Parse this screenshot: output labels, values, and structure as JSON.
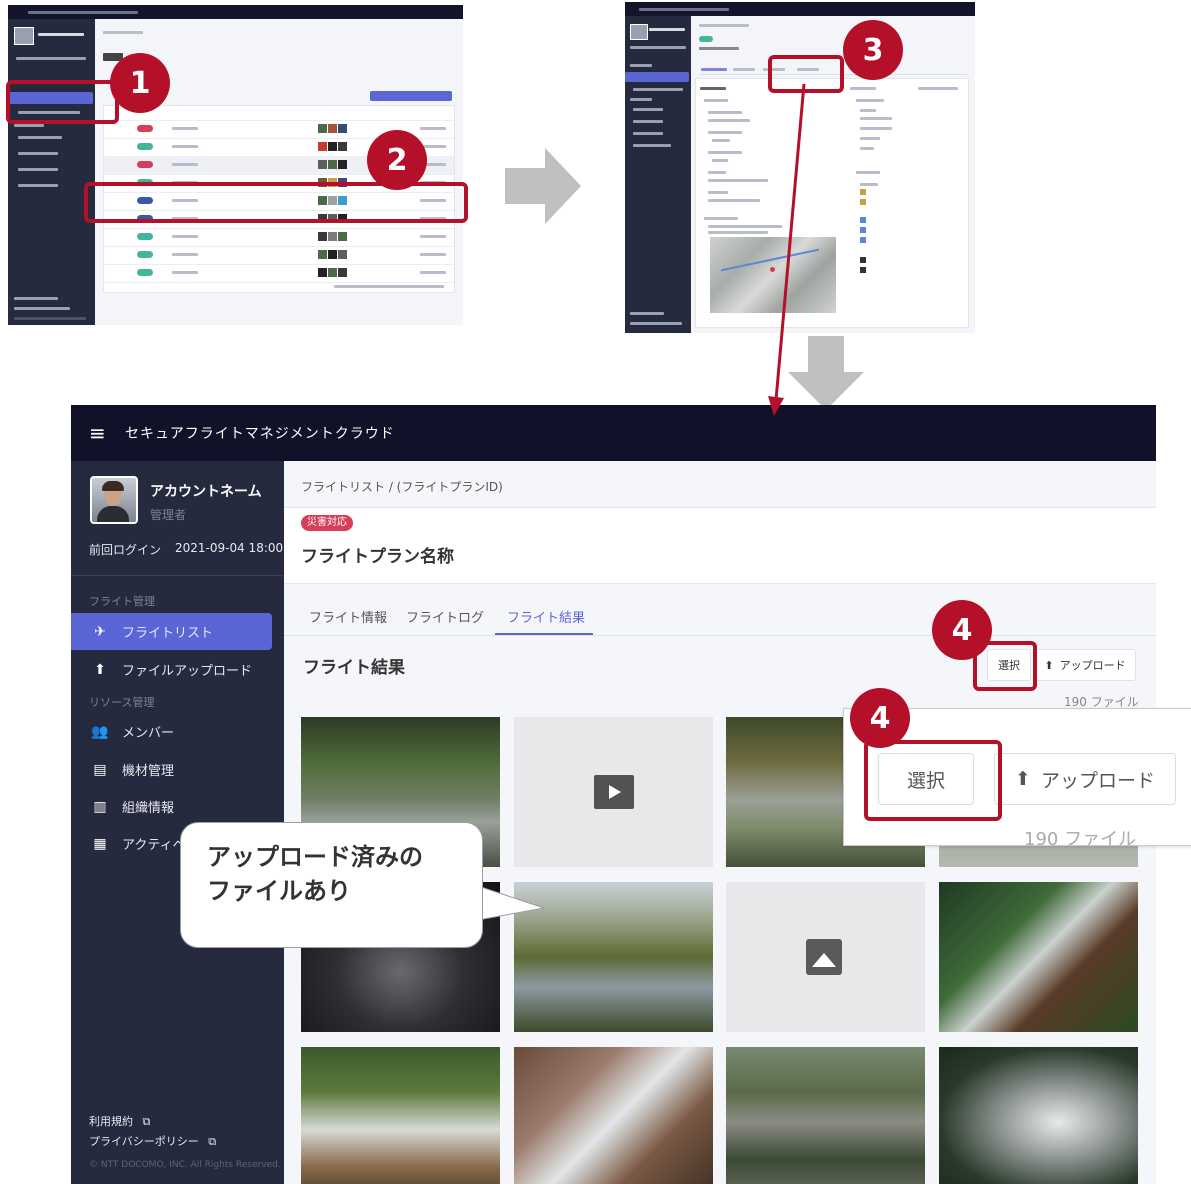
{
  "app": {
    "title": "セキュアフライトマネジメントクラウド",
    "menu_icon": "≡",
    "account": {
      "name": "アカウントネーム",
      "role": "管理者",
      "last_login_label": "前回ログイン",
      "last_login_value": "2021-09-04 18:00"
    },
    "sidebar": {
      "section_flight": "フライト管理",
      "section_resource": "リソース管理",
      "items": [
        {
          "label": "フライトリスト",
          "icon": "✈"
        },
        {
          "label": "ファイルアップロード",
          "icon": "⬆"
        },
        {
          "label": "メンバー",
          "icon": "👥"
        },
        {
          "label": "機材管理",
          "icon": "▤"
        },
        {
          "label": "組織情報",
          "icon": "▥"
        },
        {
          "label": "アクティベ",
          "icon": "▦"
        }
      ],
      "terms": "利用規約",
      "privacy": "プライバシーポリシー",
      "external_icon": "⧉",
      "copyright": "© NTT DOCOMO, INC. All Rights Reserved."
    },
    "breadcrumb": "フライトリスト / (フライトプランID)",
    "tag": "災害対応",
    "plan_name": "フライトプラン名称",
    "tabs": [
      "フライト情報",
      "フライトログ",
      "フライト結果"
    ],
    "section_title": "フライト結果",
    "select_button": "選択",
    "upload_button": "アップロード",
    "upload_icon": "⬆",
    "file_count": "190 ファイル"
  },
  "zoom": {
    "select_button": "選択",
    "upload_button": "アップロード",
    "upload_icon": "⬆",
    "count_partial": "190 ファイル"
  },
  "callout": {
    "line1": "アップロード済みの",
    "line2": "ファイルあり"
  },
  "badges": [
    "1",
    "2",
    "3",
    "4",
    "4"
  ],
  "colors": {
    "accent": "#5b66d6",
    "annotation": "#b4102a",
    "topbar": "#11122a",
    "sidebar": "#262a3e",
    "tag": "#d63e5a"
  }
}
